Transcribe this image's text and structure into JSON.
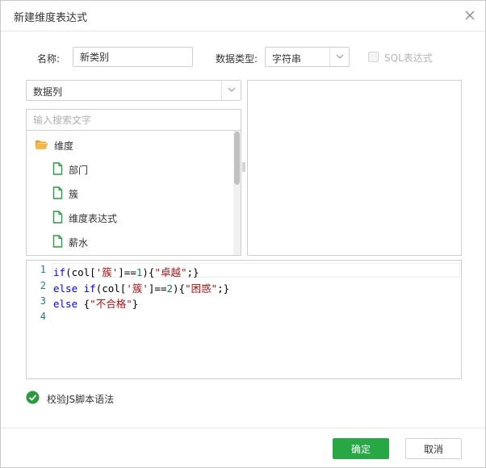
{
  "dialog": {
    "title": "新建维度表达式"
  },
  "form": {
    "name_label": "名称:",
    "name_value": "新类别",
    "type_label": "数据类型:",
    "type_value": "字符串",
    "sql_label": "SQL表达式"
  },
  "source": {
    "select_value": "数据列",
    "search_placeholder": "输入搜索文字",
    "tree": [
      {
        "label": "维度",
        "icon": "folder-open-icon"
      },
      {
        "label": "部门",
        "icon": "file-icon"
      },
      {
        "label": "簇",
        "icon": "file-icon"
      },
      {
        "label": "维度表达式",
        "icon": "file-icon"
      },
      {
        "label": "薪水",
        "icon": "file-icon"
      }
    ]
  },
  "editor": {
    "lines": [
      {
        "n": "1",
        "code": "if(col['簇']==1){\"卓越\";}"
      },
      {
        "n": "2",
        "code": "else if(col['簇']==2){\"困惑\";}"
      },
      {
        "n": "3",
        "code": "else {\"不合格\"}"
      },
      {
        "n": "4",
        "code": ""
      }
    ]
  },
  "validate": {
    "label": "校验JS脚本语法"
  },
  "footer": {
    "ok_label": "确定",
    "cancel_label": "取消"
  },
  "colors": {
    "accent": "#27a844",
    "keyword": "#0000ff",
    "string": "#a31515",
    "number": "#098658",
    "line_number": "#237893"
  }
}
